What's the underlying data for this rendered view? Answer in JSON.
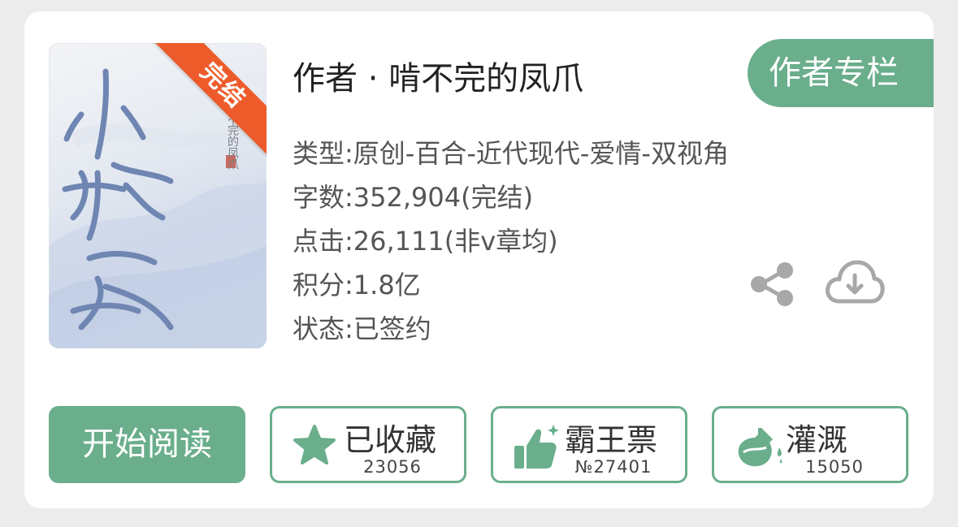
{
  "book": {
    "cover_title_chars": "小棋家",
    "cover_author": "啃不完的凤爪",
    "ribbon_label": "完结"
  },
  "author_line": "作者 · 啃不完的凤爪",
  "author_column_button": "作者专栏",
  "info": [
    "类型:原创-百合-近代现代-爱情-双视角",
    "字数:352,904(完结)",
    "点击:26,111(非v章均)",
    "积分:1.8亿",
    "状态:已签约"
  ],
  "icons": {
    "share": "share-icon",
    "download": "cloud-download-icon"
  },
  "actions": {
    "read_label": "开始阅读",
    "collect": {
      "label": "已收藏",
      "count": "23056",
      "icon": "star-icon"
    },
    "vote": {
      "label": "霸王票",
      "count": "№27401",
      "icon": "thumbs-up-icon"
    },
    "nutrient": {
      "label": "灌溉",
      "count": "15050",
      "icon": "flask-icon"
    }
  },
  "colors": {
    "accent": "#6aae8c",
    "ribbon": "#ee5b2a"
  }
}
